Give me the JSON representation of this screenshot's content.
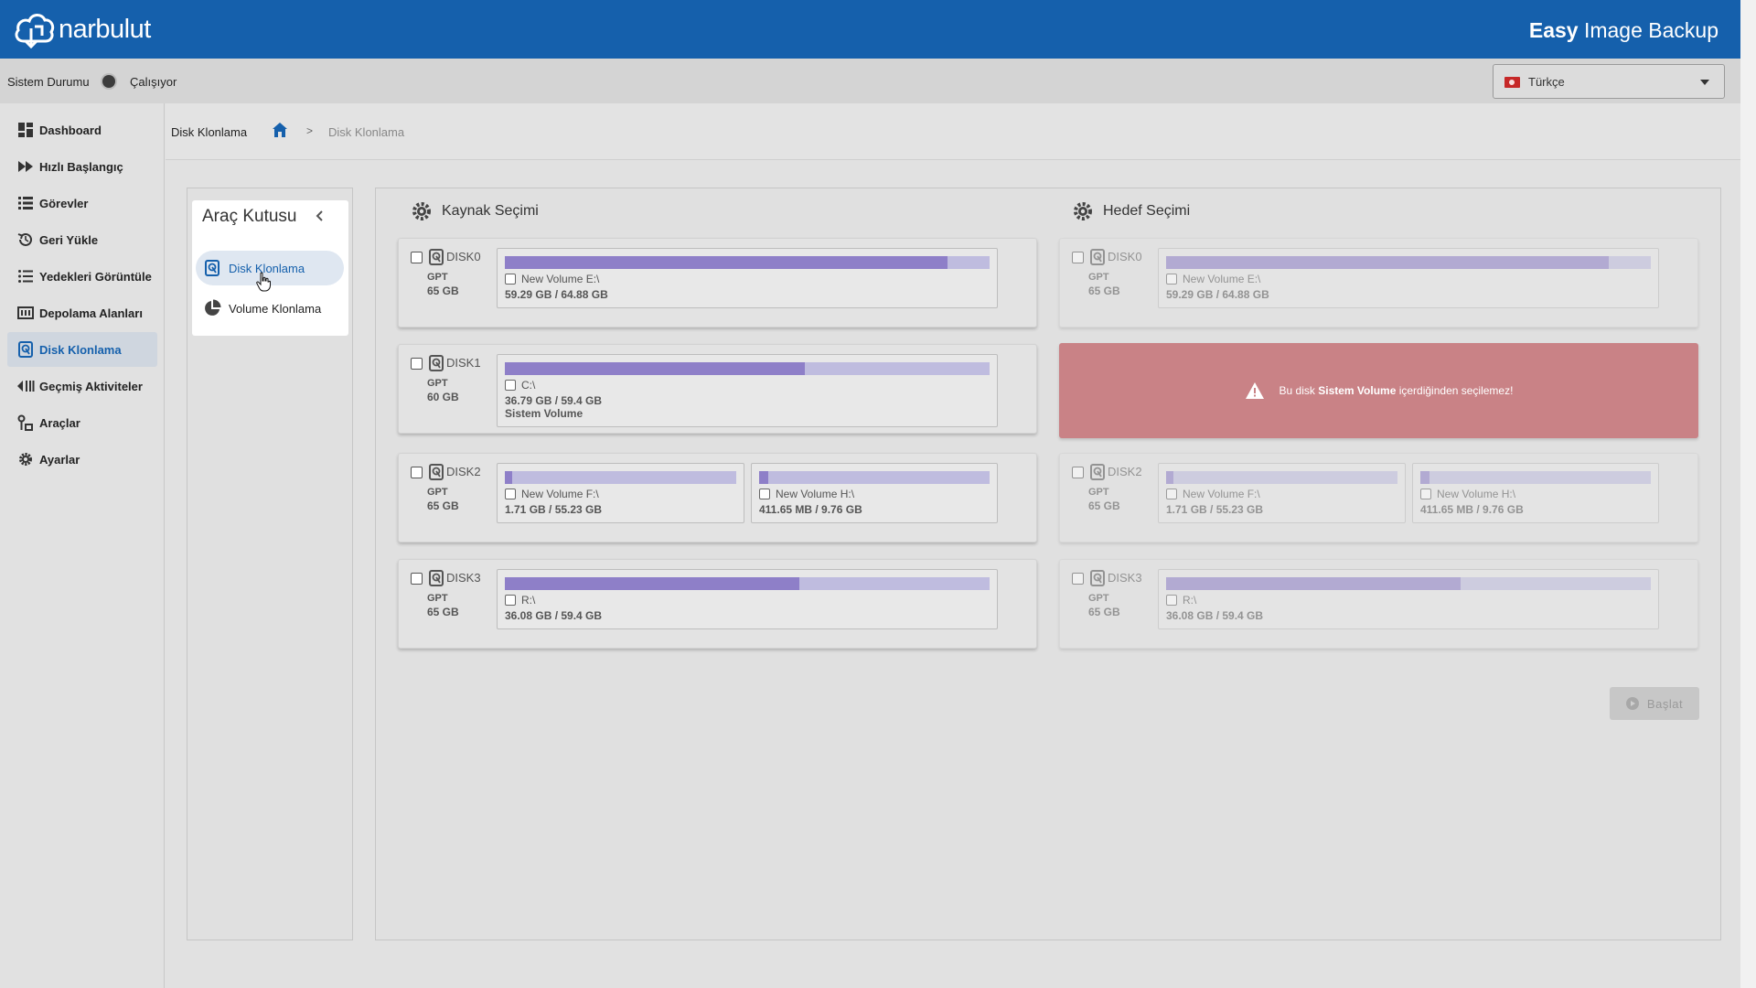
{
  "header": {
    "logo_text": "narbulut",
    "app_title_bold": "Easy",
    "app_title_rest": " Image Backup"
  },
  "status": {
    "label": "Sistem Durumu",
    "value": "Çalışıyor"
  },
  "language": {
    "selected": "Türkçe",
    "flag": "tr-flag-icon"
  },
  "sidebar": {
    "items": [
      {
        "label": "Dashboard",
        "icon": "dashboard-icon"
      },
      {
        "label": "Hızlı Başlangıç",
        "icon": "fast-forward-icon"
      },
      {
        "label": "Görevler",
        "icon": "list-icon"
      },
      {
        "label": "Geri Yükle",
        "icon": "restore-icon"
      },
      {
        "label": "Yedekleri Görüntüle",
        "icon": "list-view-icon"
      },
      {
        "label": "Depolama Alanları",
        "icon": "storage-icon"
      },
      {
        "label": "Disk Klonlama",
        "icon": "disk-icon",
        "active": true
      },
      {
        "label": "Geçmiş Aktiviteler",
        "icon": "history-icon"
      },
      {
        "label": "Araçlar",
        "icon": "tools-icon"
      },
      {
        "label": "Ayarlar",
        "icon": "gear-icon"
      }
    ]
  },
  "breadcrumb": {
    "title": "Disk Klonlama",
    "current": "Disk Klonlama",
    "separator": ">"
  },
  "toolbox": {
    "title": "Araç Kutusu",
    "items": [
      {
        "label": "Disk Klonlama",
        "icon": "disk-icon",
        "active": true
      },
      {
        "label": "Volume Klonlama",
        "icon": "pie-icon"
      }
    ]
  },
  "source": {
    "title": "Kaynak Seçimi",
    "disks": [
      {
        "name": "DISK0",
        "type": "GPT",
        "size": "65 GB",
        "volumes": [
          {
            "label": "New Volume E:\\",
            "usage": "59.29 GB / 64.88 GB",
            "used_fraction": 0.914
          }
        ]
      },
      {
        "name": "DISK1",
        "type": "GPT",
        "size": "60 GB",
        "volumes": [
          {
            "label": "C:\\",
            "usage": "36.79 GB / 59.4 GB",
            "extra": "Sistem Volume",
            "used_fraction": 0.619
          }
        ]
      },
      {
        "name": "DISK2",
        "type": "GPT",
        "size": "65 GB",
        "volumes": [
          {
            "label": "New Volume F:\\",
            "usage": "1.71 GB / 55.23 GB",
            "used_fraction": 0.031
          },
          {
            "label": "New Volume H:\\",
            "usage": "411.65 MB / 9.76 GB",
            "used_fraction": 0.041
          }
        ]
      },
      {
        "name": "DISK3",
        "type": "GPT",
        "size": "65 GB",
        "volumes": [
          {
            "label": "R:\\",
            "usage": "36.08 GB / 59.4 GB",
            "used_fraction": 0.607
          }
        ]
      }
    ]
  },
  "target": {
    "title": "Hedef Seçimi",
    "alert_prefix": "Bu disk ",
    "alert_bold": "Sistem Volume",
    "alert_suffix": " içerdiğinden seçilemez!",
    "disks": [
      {
        "name": "DISK0",
        "type": "GPT",
        "size": "65 GB",
        "volumes": [
          {
            "label": "New Volume E:\\",
            "usage": "59.29 GB / 64.88 GB",
            "used_fraction": 0.914
          }
        ]
      },
      {
        "name": "DISK2",
        "type": "GPT",
        "size": "65 GB",
        "volumes": [
          {
            "label": "New Volume F:\\",
            "usage": "1.71 GB / 55.23 GB",
            "used_fraction": 0.031
          },
          {
            "label": "New Volume H:\\",
            "usage": "411.65 MB / 9.76 GB",
            "used_fraction": 0.041
          }
        ]
      },
      {
        "name": "DISK3",
        "type": "GPT",
        "size": "65 GB",
        "volumes": [
          {
            "label": "R:\\",
            "usage": "36.08 GB / 59.4 GB",
            "used_fraction": 0.607
          }
        ]
      }
    ]
  },
  "actions": {
    "start_label": "Başlat"
  },
  "colors": {
    "brand": "#1560ac",
    "bar_fill": "#8e7fc8",
    "bar_track": "#bfbcdf",
    "alert_bg": "#c98286"
  }
}
